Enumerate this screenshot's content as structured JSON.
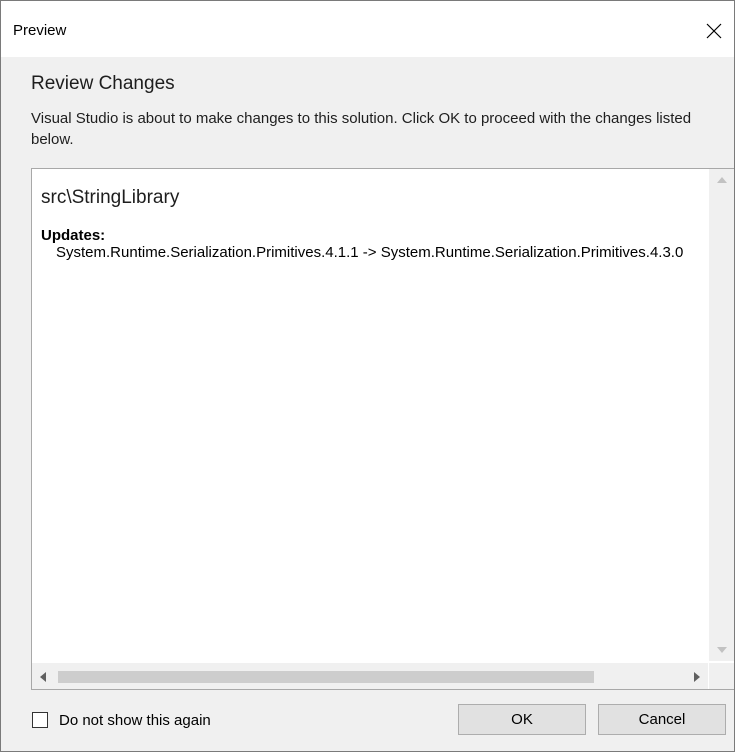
{
  "window": {
    "title": "Preview",
    "close_icon": "close-icon"
  },
  "header": {
    "heading": "Review Changes",
    "description": "Visual Studio is about to make changes to this solution. Click OK to proceed with the changes listed below."
  },
  "changes": {
    "project": "src\\StringLibrary",
    "updates_label": "Updates:",
    "update_line": "System.Runtime.Serialization.Primitives.4.1.1 -> System.Runtime.Serialization.Primitives.4.3.0"
  },
  "footer": {
    "checkbox_label": "Do not show this again",
    "checkbox_checked": false,
    "ok_label": "OK",
    "cancel_label": "Cancel"
  }
}
